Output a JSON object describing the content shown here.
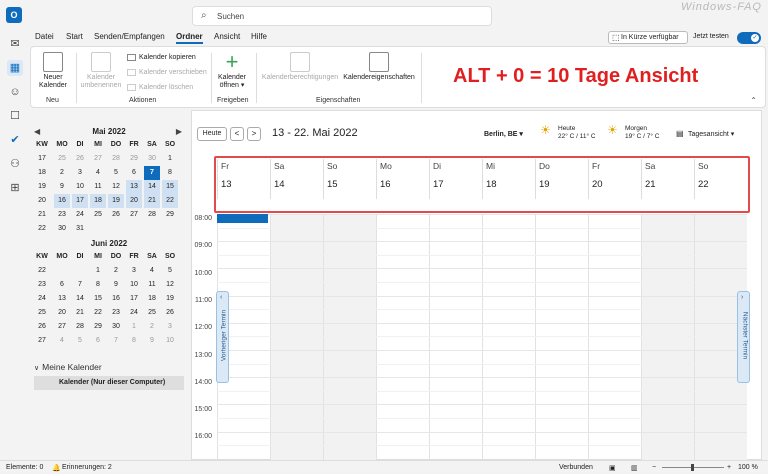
{
  "app": {
    "logo": "O",
    "search_placeholder": "Suchen",
    "watermark": "Windows-FAQ"
  },
  "rail": [
    "mail-icon",
    "calendar-icon",
    "people-icon",
    "tasks-icon",
    "todo-icon",
    "groups-icon",
    "apps-icon"
  ],
  "tabs": [
    "Datei",
    "Start",
    "Senden/Empfangen",
    "Ordner",
    "Ansicht",
    "Hilfe"
  ],
  "active_tab": "Ordner",
  "coming_soon": "In Kürze verfügbar",
  "try_label": "Jetzt testen",
  "toggle_state": "on",
  "ribbon": {
    "neu": {
      "btn": "Neuer\nKalender",
      "group": "Neu"
    },
    "aktionen": {
      "umbenennen": "Kalender\numbenennen",
      "kopieren": "Kalender kopieren",
      "verschieben": "Kalender verschieben",
      "loeschen": "Kalender löschen",
      "group": "Aktionen"
    },
    "freigeben": {
      "oeffnen": "Kalender\nöffnen ▾",
      "group": "Freigeben"
    },
    "eigenschaften": {
      "berechtigungen": "Kalenderberechtigungen",
      "eigenschaften": "Kalendereigenschaften",
      "group": "Eigenschaften"
    }
  },
  "annotation": "ALT + 0 = 10 Tage Ansicht",
  "weekday_header": [
    "KW",
    "MO",
    "DI",
    "MI",
    "DO",
    "FR",
    "SA",
    "SO"
  ],
  "months": [
    {
      "title": "Mai 2022",
      "rows": [
        {
          "kw": "17",
          "days": [
            "25",
            "26",
            "27",
            "28",
            "29",
            "30",
            "1"
          ],
          "dim": [
            true,
            true,
            true,
            true,
            true,
            true,
            false
          ]
        },
        {
          "kw": "18",
          "days": [
            "2",
            "3",
            "4",
            "5",
            "6",
            "7",
            "8"
          ]
        },
        {
          "kw": "19",
          "days": [
            "9",
            "10",
            "11",
            "12",
            "13",
            "14",
            "15"
          ]
        },
        {
          "kw": "20",
          "days": [
            "16",
            "17",
            "18",
            "19",
            "20",
            "21",
            "22"
          ]
        },
        {
          "kw": "21",
          "days": [
            "23",
            "24",
            "25",
            "26",
            "27",
            "28",
            "29"
          ]
        },
        {
          "kw": "22",
          "days": [
            "30",
            "31"
          ]
        }
      ]
    },
    {
      "title": "Juni 2022",
      "rows": [
        {
          "kw": "22",
          "days": [
            "",
            "",
            "1",
            "2",
            "3",
            "4",
            "5"
          ]
        },
        {
          "kw": "23",
          "days": [
            "6",
            "7",
            "8",
            "9",
            "10",
            "11",
            "12"
          ]
        },
        {
          "kw": "24",
          "days": [
            "13",
            "14",
            "15",
            "16",
            "17",
            "18",
            "19"
          ]
        },
        {
          "kw": "25",
          "days": [
            "20",
            "21",
            "22",
            "23",
            "24",
            "25",
            "26"
          ]
        },
        {
          "kw": "26",
          "days": [
            "27",
            "28",
            "29",
            "30",
            "1",
            "2",
            "3"
          ],
          "dim": [
            false,
            false,
            false,
            false,
            true,
            true,
            true
          ]
        },
        {
          "kw": "27",
          "days": [
            "4",
            "5",
            "6",
            "7",
            "8",
            "9",
            "10"
          ],
          "dim": [
            true,
            true,
            true,
            true,
            true,
            true,
            true
          ]
        }
      ]
    }
  ],
  "my_calendars": "Meine Kalender",
  "calendar_item": "Kalender (Nur dieser Computer)",
  "nav": {
    "today": "Heute",
    "prev": "<",
    "next": ">",
    "range": "13 - 22. Mai 2022"
  },
  "weather": {
    "location": "Berlin, BE ▾",
    "today": {
      "label": "Heute",
      "temp": "22° C / 11° C"
    },
    "tomorrow": {
      "label": "Morgen",
      "temp": "19° C / 7° C"
    }
  },
  "view_label": "Tagesansicht ▾",
  "days": [
    {
      "name": "Fr",
      "num": "13"
    },
    {
      "name": "Sa",
      "num": "14"
    },
    {
      "name": "So",
      "num": "15"
    },
    {
      "name": "Mo",
      "num": "16"
    },
    {
      "name": "Di",
      "num": "17"
    },
    {
      "name": "Mi",
      "num": "18"
    },
    {
      "name": "Do",
      "num": "19"
    },
    {
      "name": "Fr",
      "num": "20"
    },
    {
      "name": "Sa",
      "num": "21"
    },
    {
      "name": "So",
      "num": "22"
    }
  ],
  "times": [
    "08:00",
    "09:00",
    "10:00",
    "11:00",
    "12:00",
    "13:00",
    "14:00",
    "15:00",
    "16:00"
  ],
  "prev_appt": "Vorheriger Termin",
  "next_appt": "Nächster Termin",
  "status": {
    "elements": "Elemente: 0",
    "reminders": "Erinnerungen: 2",
    "connected": "Verbunden",
    "zoom": "100 %"
  },
  "colors": {
    "accent": "#0f6cbd",
    "annotation": "#e02020",
    "highlight_box": "#e34a4a"
  }
}
